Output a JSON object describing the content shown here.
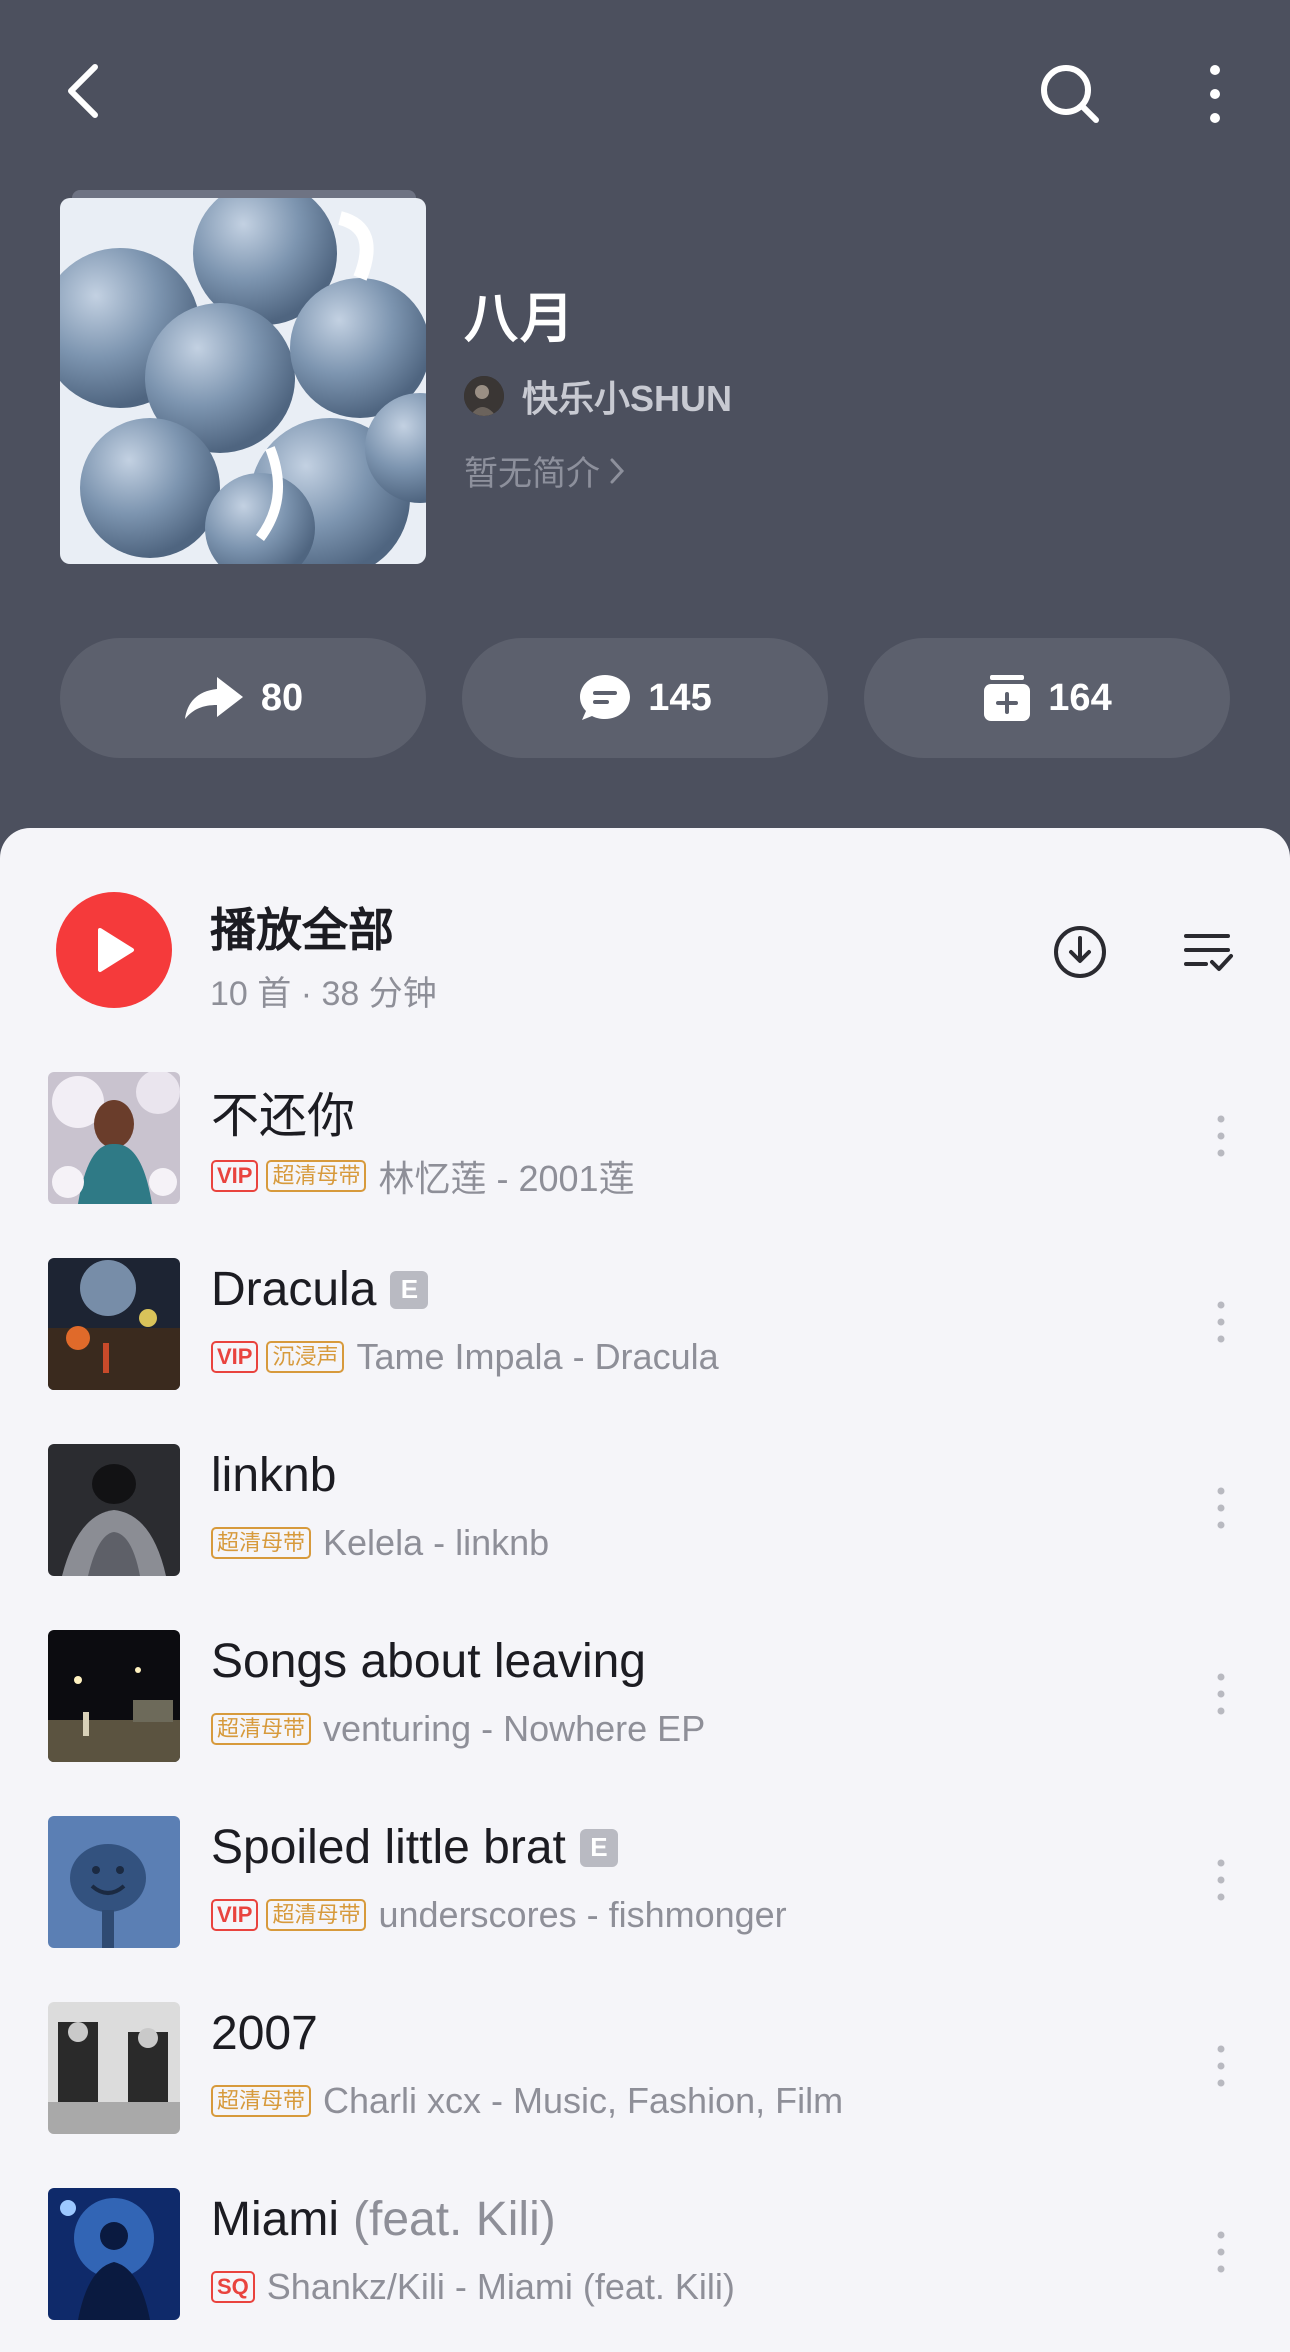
{
  "playlist": {
    "title": "八月",
    "creator": "快乐小SHUN",
    "intro": "暂无简介"
  },
  "actions": {
    "share_count": "80",
    "comment_count": "145",
    "collect_count": "164"
  },
  "play_all": {
    "label": "播放全部",
    "meta": "10 首 · 38 分钟"
  },
  "songs": [
    {
      "title": "不还你",
      "explicit": false,
      "badges": [
        "VIP",
        "超清母带"
      ],
      "artist": "林忆莲 - 2001莲"
    },
    {
      "title": "Dracula",
      "explicit": true,
      "explicit_label": "E",
      "badges": [
        "VIP",
        "沉浸声"
      ],
      "artist": "Tame Impala - Dracula"
    },
    {
      "title": "linknb",
      "explicit": false,
      "badges": [
        "超清母带"
      ],
      "artist": "Kelela - linknb"
    },
    {
      "title": "Songs about leaving",
      "explicit": false,
      "badges": [
        "超清母带"
      ],
      "artist": "venturing - Nowhere EP"
    },
    {
      "title": "Spoiled little brat",
      "explicit": true,
      "explicit_label": "E",
      "badges": [
        "VIP",
        "超清母带"
      ],
      "artist": "underscores - fishmonger"
    },
    {
      "title": "2007",
      "explicit": false,
      "badges": [
        "超清母带"
      ],
      "artist": "Charli xcx - Music, Fashion, Film"
    },
    {
      "title": "Miami",
      "feat": "(feat. Kili)",
      "explicit": false,
      "badges": [
        "SQ"
      ],
      "artist": "Shankz/Kili - Miami (feat. Kili)"
    }
  ],
  "colors": {
    "header_bg": "#4c505e",
    "accent_red": "#f53a3b",
    "badge_gold": "#d79a3c"
  }
}
